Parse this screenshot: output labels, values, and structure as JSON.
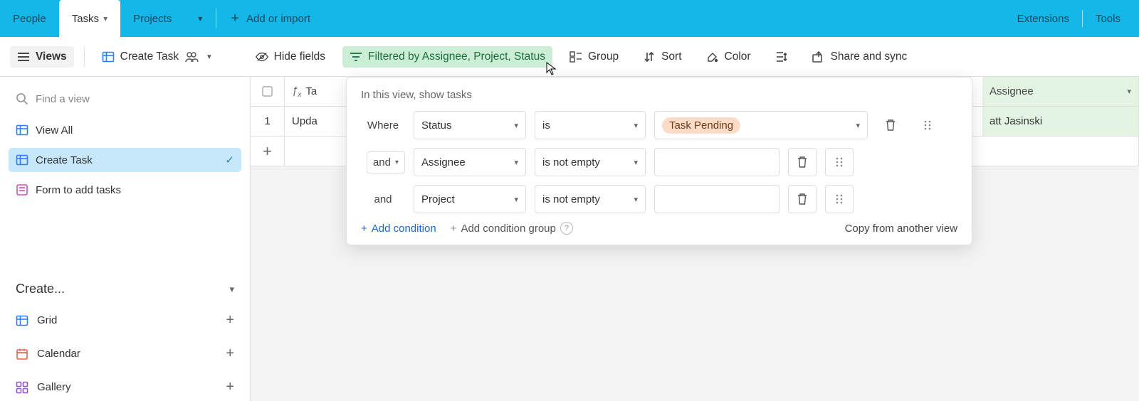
{
  "topnav": {
    "tabs": {
      "people": "People",
      "tasks": "Tasks",
      "projects": "Projects"
    },
    "add_or_import": "Add or import",
    "extensions": "Extensions",
    "tools": "Tools"
  },
  "toolbar": {
    "views": "Views",
    "create_task": "Create Task",
    "hide_fields": "Hide fields",
    "filter_label": "Filtered by Assignee, Project, Status",
    "group": "Group",
    "sort": "Sort",
    "color": "Color",
    "share": "Share and sync"
  },
  "sidebar": {
    "search_placeholder": "Find a view",
    "views": {
      "view_all": "View All",
      "create_task": "Create Task",
      "form": "Form to add tasks"
    },
    "create_header": "Create...",
    "options": {
      "grid": "Grid",
      "calendar": "Calendar",
      "gallery": "Gallery"
    }
  },
  "grid": {
    "headers": {
      "task": "Ta",
      "assignee": "Assignee"
    },
    "rows": [
      {
        "num": "1",
        "task": "Upda",
        "assignee": "att Jasinski"
      }
    ]
  },
  "filter": {
    "title": "In this view, show tasks",
    "where": "Where",
    "and": "and",
    "conditions": [
      {
        "field": "Status",
        "operator": "is",
        "value": "Task Pending",
        "value_style": "pill"
      },
      {
        "field": "Assignee",
        "operator": "is not empty",
        "value": "",
        "value_style": "empty"
      },
      {
        "field": "Project",
        "operator": "is not empty",
        "value": "",
        "value_style": "empty"
      }
    ],
    "add_condition": "Add condition",
    "add_group": "Add condition group",
    "copy_from": "Copy from another view"
  }
}
